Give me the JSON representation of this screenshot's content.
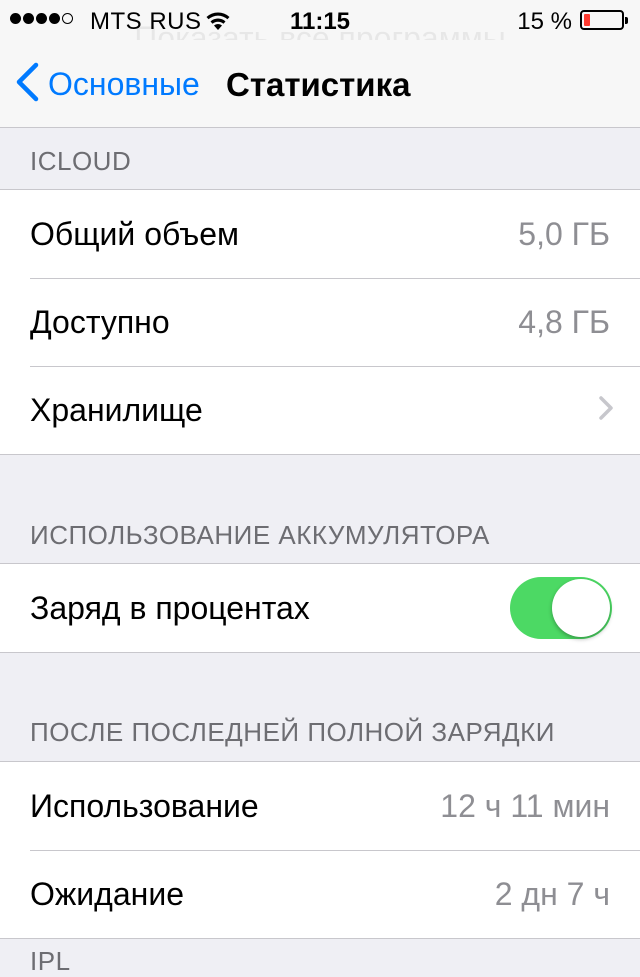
{
  "status_bar": {
    "carrier": "MTS RUS",
    "time": "11:15",
    "battery_percent": "15 %",
    "battery_level": 0.15,
    "signal_bars_filled": 4,
    "signal_bars_total": 5
  },
  "ghost_text": "Показать все программы",
  "nav": {
    "back_label": "Основные",
    "title": "Статистика"
  },
  "sections": {
    "icloud": {
      "header": "ICLOUD",
      "rows": [
        {
          "label": "Общий объем",
          "value": "5,0 ГБ"
        },
        {
          "label": "Доступно",
          "value": "4,8 ГБ"
        },
        {
          "label": "Хранилище"
        }
      ]
    },
    "battery_usage": {
      "header": "ИСПОЛЬЗОВАНИЕ АККУМУЛЯТОРА",
      "rows": [
        {
          "label": "Заряд в процентах",
          "toggle_on": true
        }
      ]
    },
    "since_charge": {
      "header": "ПОСЛЕ ПОСЛЕДНЕЙ ПОЛНОЙ ЗАРЯДКИ",
      "rows": [
        {
          "label": "Использование",
          "value": "12 ч 11 мин"
        },
        {
          "label": "Ожидание",
          "value": "2 дн 7 ч"
        }
      ]
    },
    "next_header": "IPL"
  },
  "colors": {
    "accent": "#007aff",
    "toggle_on": "#4cd964",
    "battery_low": "#ff3b30",
    "group_background": "#efeff4"
  }
}
